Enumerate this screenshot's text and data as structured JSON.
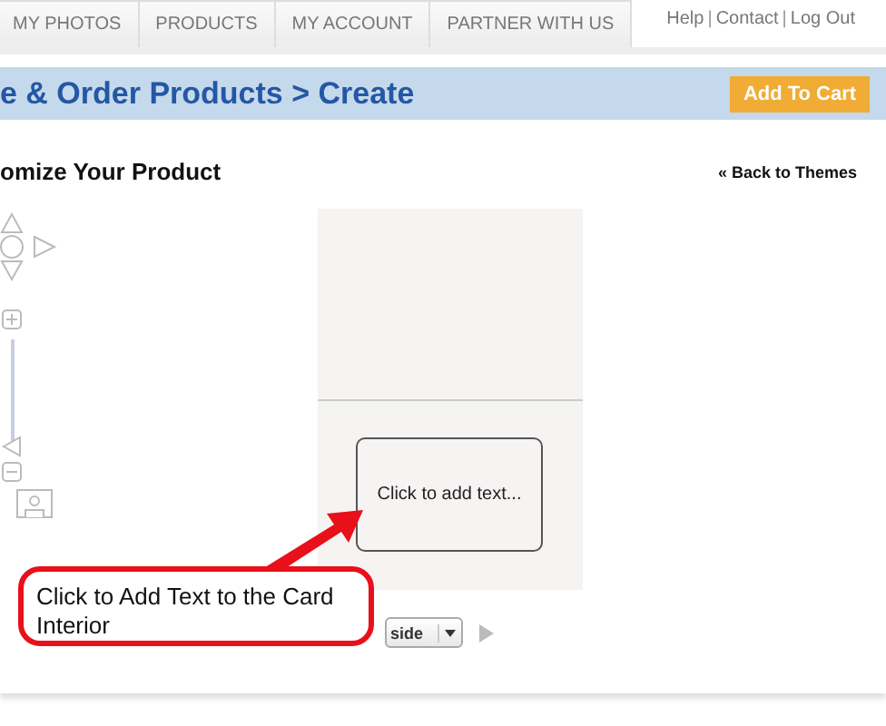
{
  "nav": {
    "tabs": [
      {
        "label": "MY PHOTOS"
      },
      {
        "label": "PRODUCTS"
      },
      {
        "label": "MY ACCOUNT"
      },
      {
        "label": "PARTNER WITH US"
      }
    ],
    "links": [
      "Help",
      "Contact",
      "Log Out"
    ],
    "separator": "|"
  },
  "header": {
    "title": "e & Order Products > Create",
    "button": "Add To Cart"
  },
  "section": {
    "title": "omize Your Product",
    "back_link": "« Back to Themes"
  },
  "card": {
    "placeholder": "Click to add text..."
  },
  "view_select": {
    "value": "side"
  },
  "callout": {
    "text": "Click to Add Text to the Card Interior"
  }
}
